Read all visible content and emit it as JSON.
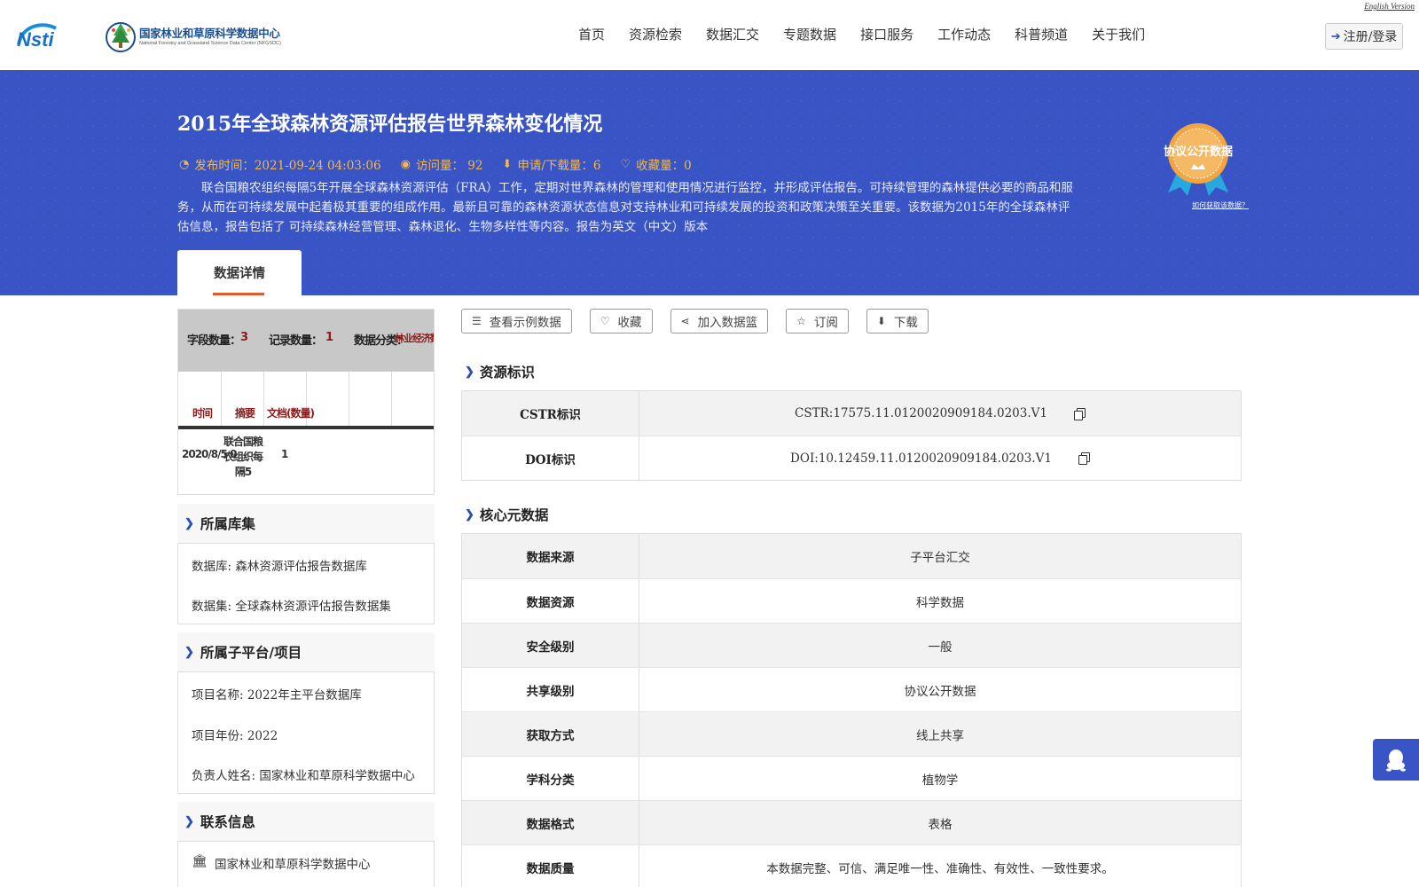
{
  "header": {
    "logo_nsti_text": "Nsti",
    "logo_center_cn": "国家林业和草原科学数据中心",
    "logo_center_en": "National Forestry and Grassland Science Data Center (NFGSDC)",
    "english_version": "English Version",
    "nav": [
      "首页",
      "资源检索",
      "数据汇交",
      "专题数据",
      "接口服务",
      "工作动态",
      "科普频道",
      "关于我们"
    ],
    "login_label": "注册/登录",
    "login_icon": "sign-in-icon"
  },
  "banner": {
    "title": "2015年全球森林资源评估报告世界森林变化情况",
    "stats": {
      "publish": "发布时间：2021-09-24 04:03:06",
      "visits": "访问量： 92",
      "downloads": "申请/下载量：6",
      "favorites": "收藏量：0"
    },
    "description": "联合国粮农组织每隔5年开展全球森林资源评估（FRA）工作，定期对世界森林的管理和使用情况进行监控，并形成评估报告。可持续管理的森林提供必要的商品和服务，从而在可持续发展中起着极其重要的组成作用。最新且可靠的森林资源状态信息对支持林业和可持续发展的投资和政策决策至关重要。该数据为2015年的全球森林评估信息，报告包括了 可持续森林经营管理、森林退化、生物多样性等内容。报告为英文（中文）版本",
    "badge_text": "协议公开数据",
    "badge_link": "如何获取该数据？",
    "tab_label": "数据详情"
  },
  "preview": {
    "top_labels": [
      "字段数量：",
      "3",
      "记录数量：",
      "1",
      "数据分类：",
      "林业经济数据"
    ],
    "headers": [
      "时间",
      "摘要",
      "文档(数量)"
    ],
    "cells": [
      "2020/8/5 0",
      "联合国粮农组织每隔5",
      "1"
    ]
  },
  "sidebar": {
    "library_title": "所属库集",
    "library_rows": [
      "数据库: 森林资源评估报告数据库",
      "数据集: 全球森林资源评估报告数据集"
    ],
    "project_title": "所属子平台/项目",
    "project_rows": [
      "项目名称: 2022年主平台数据库",
      "项目年份: 2022",
      "负责人姓名: 国家林业和草原科学数据中心"
    ],
    "contact_title": "联系信息",
    "contact_rows": [
      "国家林业和草原科学数据中心"
    ]
  },
  "toolbar": {
    "view_sample": "查看示例数据",
    "favorite": "收藏",
    "add_basket": "加入数据篮",
    "subscribe": "订阅",
    "download": "下载"
  },
  "identifiers": {
    "title": "资源标识",
    "rows": [
      {
        "key": "CSTR标识",
        "value": "CSTR:17575.11.0120020909184.0203.V1"
      },
      {
        "key": "DOI标识",
        "value": "DOI:10.12459.11.0120020909184.0203.V1"
      }
    ]
  },
  "core": {
    "title": "核心元数据",
    "rows": [
      {
        "key": "数据来源",
        "value": "子平台汇交"
      },
      {
        "key": "数据资源",
        "value": "科学数据"
      },
      {
        "key": "安全级别",
        "value": "一般"
      },
      {
        "key": "共享级别",
        "value": "协议公开数据"
      },
      {
        "key": "获取方式",
        "value": "线上共享"
      },
      {
        "key": "学科分类",
        "value": "植物学"
      },
      {
        "key": "数据格式",
        "value": "表格"
      },
      {
        "key": "数据质量",
        "value": "本数据完整、可信、满足唯一性、准确性、有效性、一致性要求。"
      }
    ]
  },
  "colors": {
    "banner": "#3954c4",
    "accent_orange": "#f5b94a",
    "chevron_blue": "#2b4fb0",
    "tab_underline": "#e05a2a"
  }
}
